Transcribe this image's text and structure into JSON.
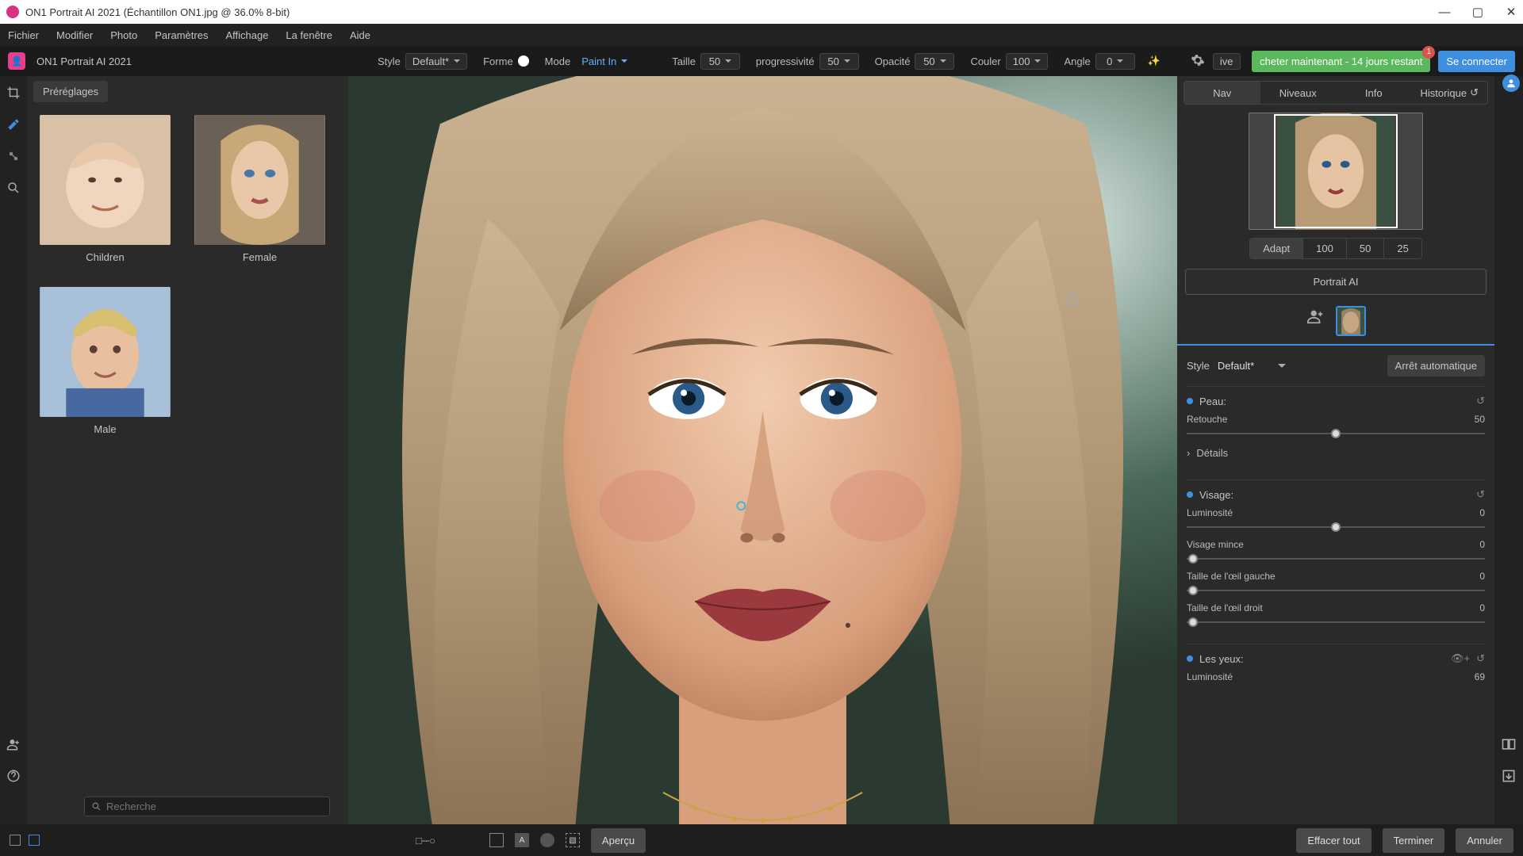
{
  "titlebar": {
    "text": "ON1 Portrait AI 2021 (Échantillon ON1.jpg @ 36.0% 8-bit)"
  },
  "menubar": [
    "Fichier",
    "Modifier",
    "Photo",
    "Paramètres",
    "Affichage",
    "La fenêtre",
    "Aide"
  ],
  "secbar": {
    "app": "ON1 Portrait AI 2021",
    "style_label": "Style",
    "style_value": "Default*",
    "forme_label": "Forme",
    "mode_label": "Mode",
    "mode_value": "Paint In",
    "taille_label": "Taille",
    "taille_value": "50",
    "prog_label": "progressivité",
    "prog_value": "50",
    "opacite_label": "Opacité",
    "opacite_value": "50",
    "couler_label": "Couler",
    "couler_value": "100",
    "angle_label": "Angle",
    "angle_value": "0",
    "pref_btn": "ive",
    "buy": "cheter maintenant - 14 jours restant",
    "buy_badge": "1",
    "login": "Se connecter"
  },
  "presets": {
    "tab": "Préréglages",
    "items": [
      {
        "label": "Children",
        "bg": "#c8a68a"
      },
      {
        "label": "Female",
        "bg": "#9e8d7a"
      },
      {
        "label": "Male",
        "bg": "#7a90a8"
      }
    ],
    "search_placeholder": "Recherche"
  },
  "right": {
    "tabs": {
      "nav": "Nav",
      "niveaux": "Niveaux",
      "info": "Info",
      "historique": "Historique"
    },
    "zoom": {
      "adapt": "Adapt",
      "z100": "100",
      "z50": "50",
      "z25": "25"
    },
    "portrait_btn": "Portrait AI",
    "style_label": "Style",
    "style_value": "Default*",
    "auto": "Arrêt automatique",
    "groups": {
      "peau": {
        "title": "Peau:",
        "retouche_label": "Retouche",
        "retouche_value": "50",
        "details": "Détails"
      },
      "visage": {
        "title": "Visage:",
        "lum_label": "Luminosité",
        "lum_value": "0",
        "mince_label": "Visage mince",
        "mince_value": "0",
        "oeil_g_label": "Taille de l'œil gauche",
        "oeil_g_value": "0",
        "oeil_d_label": "Taille de l'œil droit",
        "oeil_d_value": "0"
      },
      "yeux": {
        "title": "Les yeux:",
        "lum_label": "Luminosité",
        "lum_value": "69"
      }
    }
  },
  "footer": {
    "apercu": "Aperçu",
    "effacer": "Effacer tout",
    "terminer": "Terminer",
    "annuler": "Annuler"
  }
}
